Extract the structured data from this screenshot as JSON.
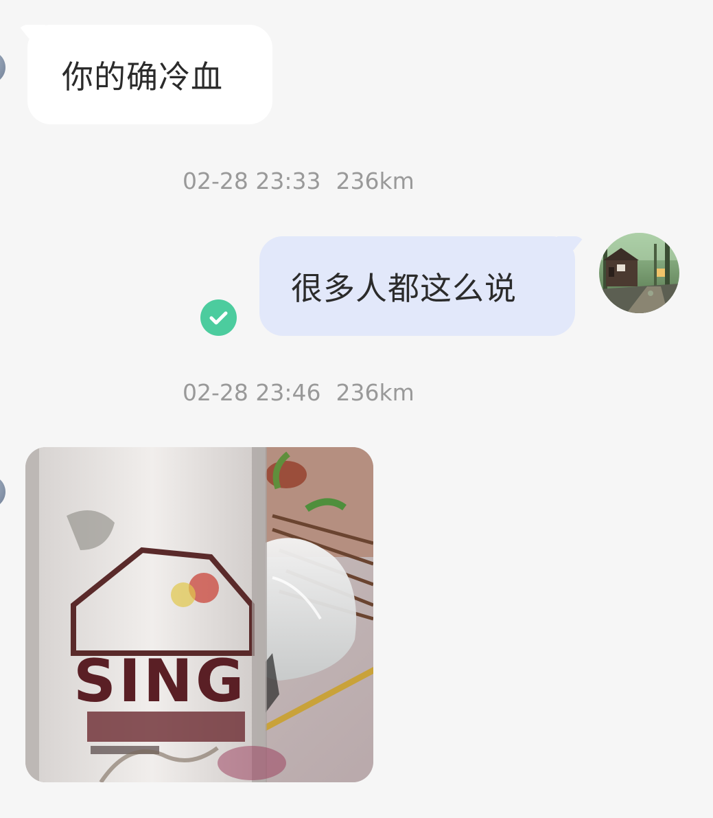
{
  "messages": [
    {
      "direction": "incoming",
      "type": "text",
      "text": "你的确冷血"
    },
    {
      "direction": "outgoing",
      "type": "text",
      "text": "很多人都这么说",
      "status": "read",
      "meta": {
        "time": "02-28 23:33",
        "distance": "236km"
      }
    },
    {
      "direction": "incoming",
      "type": "image",
      "image_icon": "beer-can-photo",
      "meta": {
        "time": "02-28 23:46",
        "distance": "236km"
      }
    }
  ],
  "colors": {
    "background": "#f6f6f6",
    "incoming_bubble": "#ffffff",
    "outgoing_bubble": "#e2e8fa",
    "read_check": "#4ccc9e",
    "timestamp": "#999999"
  }
}
